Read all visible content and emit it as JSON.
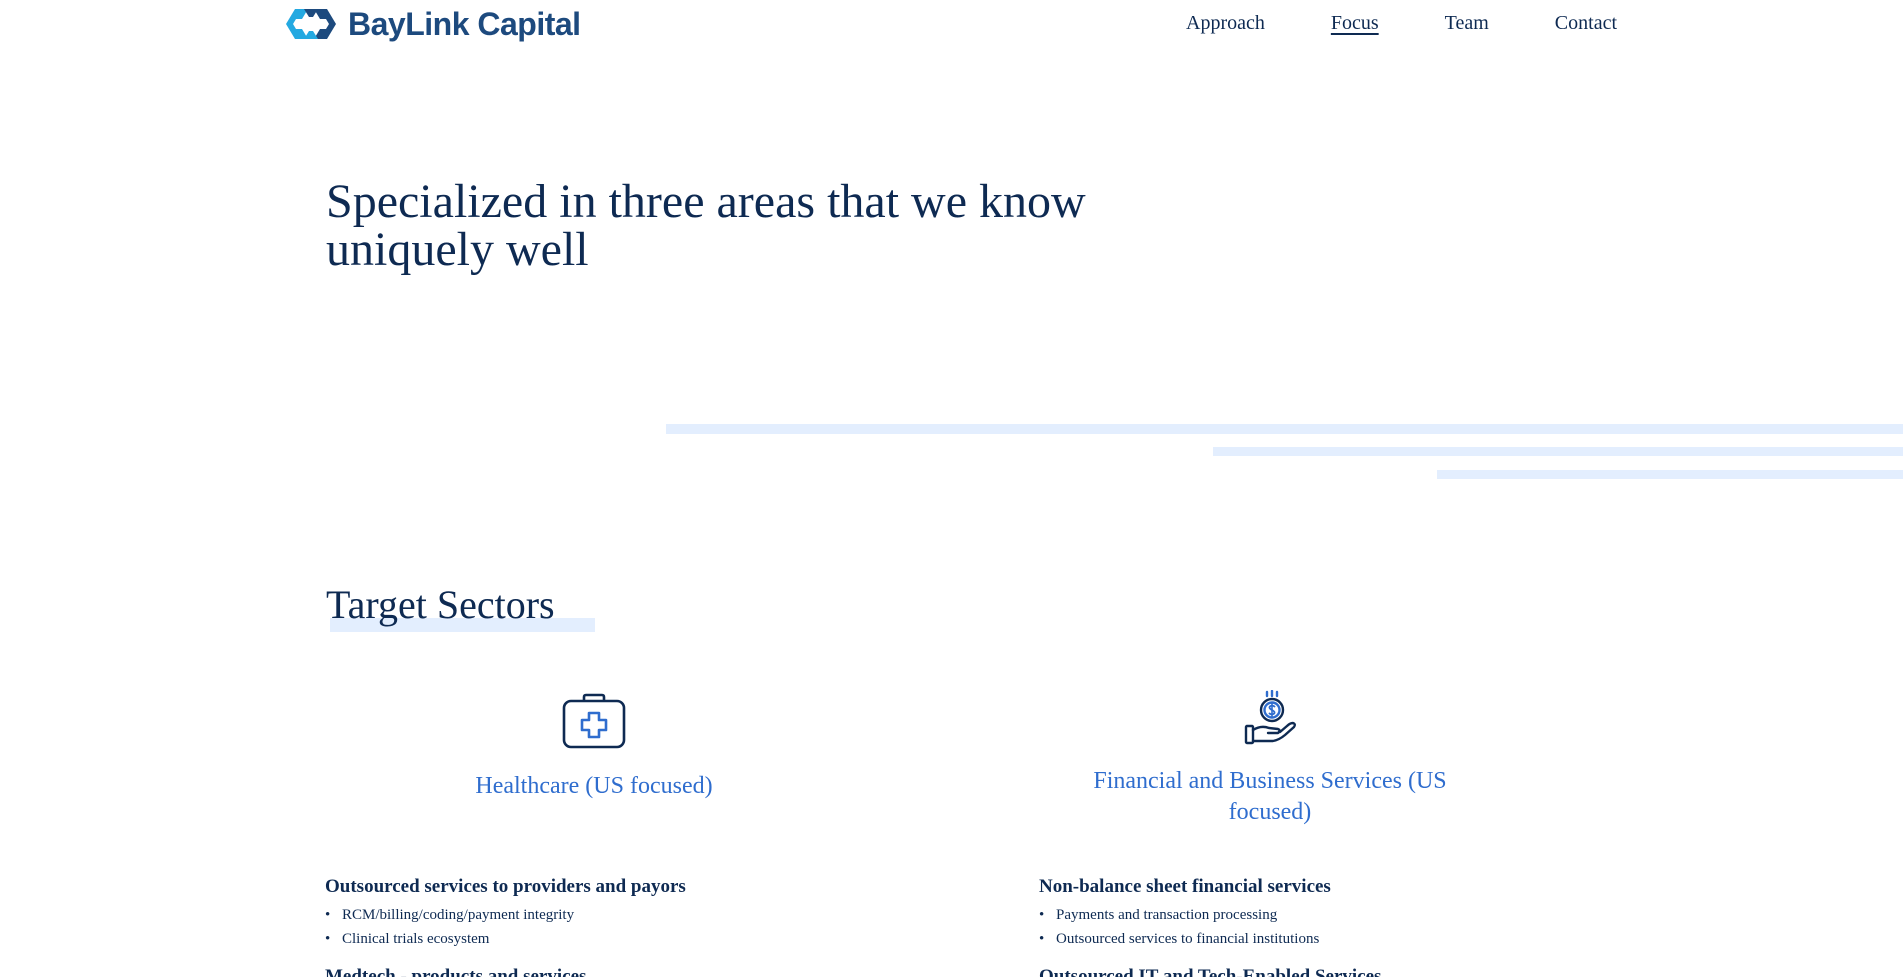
{
  "header": {
    "brand": "BayLink Capital",
    "nav": [
      {
        "label": "Approach",
        "active": false
      },
      {
        "label": "Focus",
        "active": true
      },
      {
        "label": "Team",
        "active": false
      },
      {
        "label": "Contact",
        "active": false
      }
    ]
  },
  "hero": {
    "title": "Specialized in three areas that we know uniquely well"
  },
  "target_sectors": {
    "title": "Target Sectors",
    "sectors": [
      {
        "icon": "medical-kit-icon",
        "title": "Healthcare (US focused)",
        "groups": [
          {
            "heading": "Outsourced services to providers and payors",
            "items": [
              "RCM/billing/coding/payment integrity",
              "Clinical trials ecosystem"
            ]
          },
          {
            "heading": "Medtech - products and services",
            "items": []
          }
        ]
      },
      {
        "icon": "hand-with-dollar-coin-icon",
        "title": "Financial and Business Services (US focused)",
        "groups": [
          {
            "heading": "Non-balance sheet financial services",
            "items": [
              "Payments and transaction processing",
              "Outsourced services to financial institutions"
            ]
          },
          {
            "heading": "Outsourced IT and Tech-Enabled Services",
            "items": []
          }
        ]
      }
    ]
  },
  "colors": {
    "navy": "#0e2a52",
    "brand_blue": "#1d4a7e",
    "accent_blue": "#2f6dce",
    "stripe": "#e3eefe"
  }
}
